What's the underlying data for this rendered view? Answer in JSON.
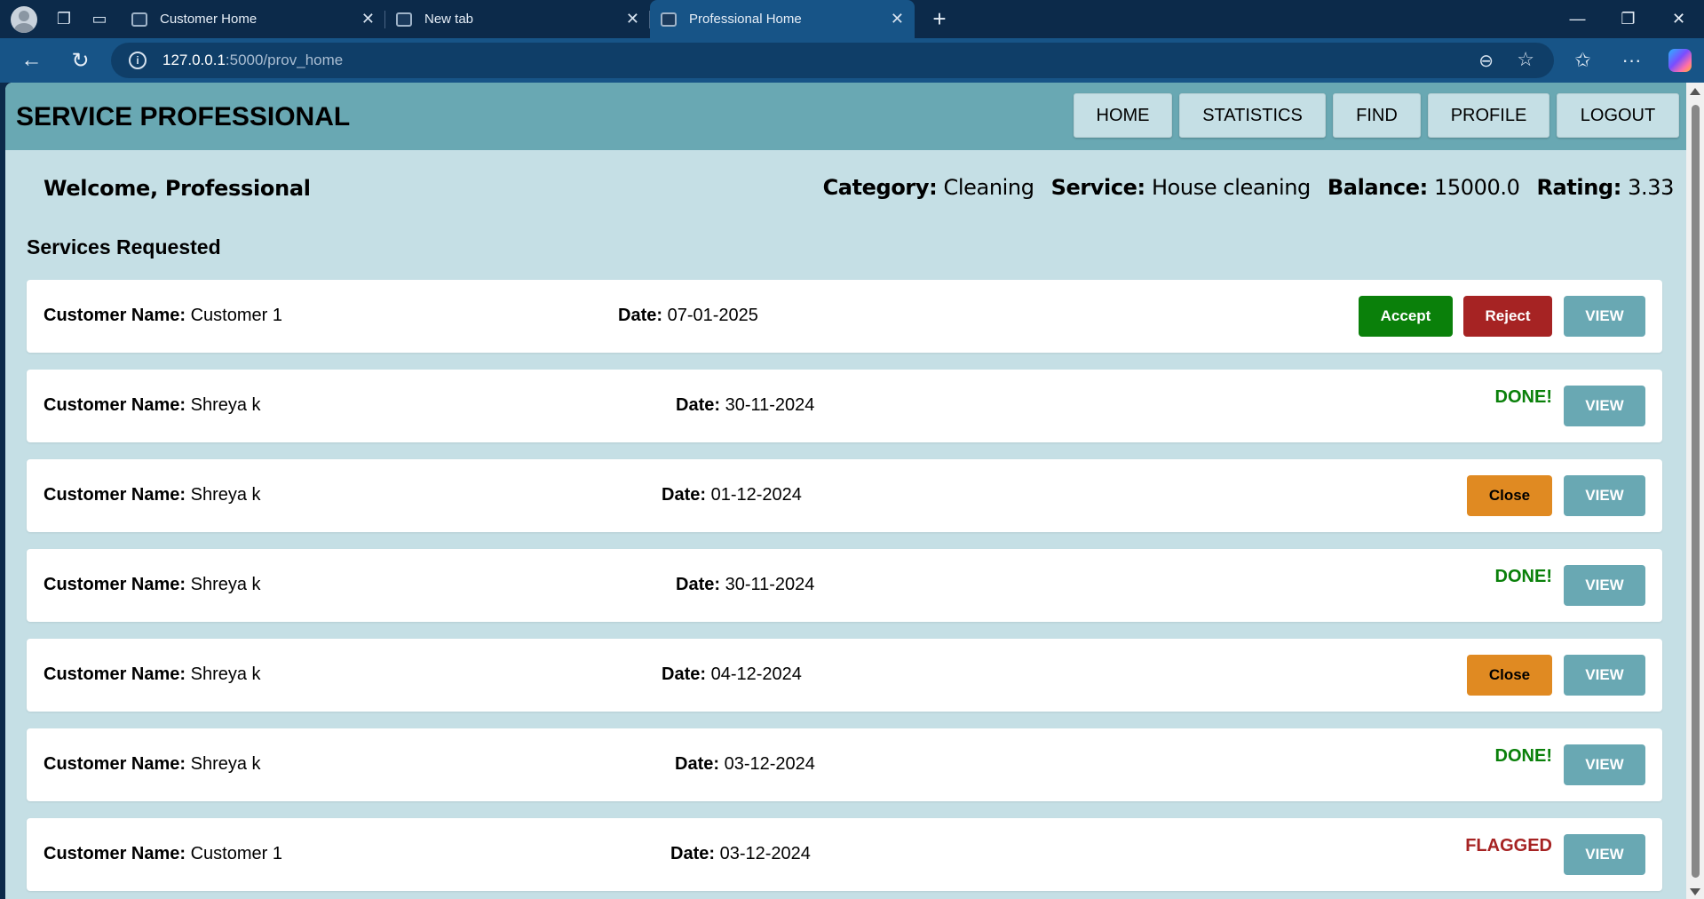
{
  "browser": {
    "tabs": [
      {
        "title": "Customer Home"
      },
      {
        "title": "New tab"
      },
      {
        "title": "Professional Home"
      }
    ],
    "url_host": "127.0.0.1",
    "url_path": ":5000/prov_home"
  },
  "header": {
    "brand": "SERVICE PROFESSIONAL",
    "menu": [
      "HOME",
      "STATISTICS",
      "FIND",
      "PROFILE",
      "LOGOUT"
    ]
  },
  "profile": {
    "welcome": "Welcome, Professional",
    "category_label": "Category:",
    "category": "Cleaning",
    "service_label": "Service:",
    "service": "House cleaning",
    "balance_label": "Balance:",
    "balance": "15000.0",
    "rating_label": "Rating:",
    "rating": "3.33"
  },
  "requests": {
    "title": "Services Requested",
    "customer_label": "Customer Name:",
    "date_label": "Date:",
    "view_label": "VIEW",
    "accept_label": "Accept",
    "reject_label": "Reject",
    "close_label": "Close",
    "items": [
      {
        "customer": "Customer 1",
        "date": "07-01-2025",
        "state": "pending"
      },
      {
        "customer": "Shreya k",
        "date": "30-11-2024",
        "state": "DONE!"
      },
      {
        "customer": "Shreya k",
        "date": "01-12-2024",
        "state": "close"
      },
      {
        "customer": "Shreya k",
        "date": "30-11-2024",
        "state": "DONE!"
      },
      {
        "customer": "Shreya k",
        "date": "04-12-2024",
        "state": "close"
      },
      {
        "customer": "Shreya k",
        "date": "03-12-2024",
        "state": "DONE!"
      },
      {
        "customer": "Customer 1",
        "date": "03-12-2024",
        "state": "FLAGGED"
      }
    ]
  },
  "colors": {
    "header_bg": "#69a8b3",
    "page_bg": "#c5dfe5",
    "accept": "#0a800a",
    "reject": "#a62323",
    "close": "#e08a22"
  }
}
